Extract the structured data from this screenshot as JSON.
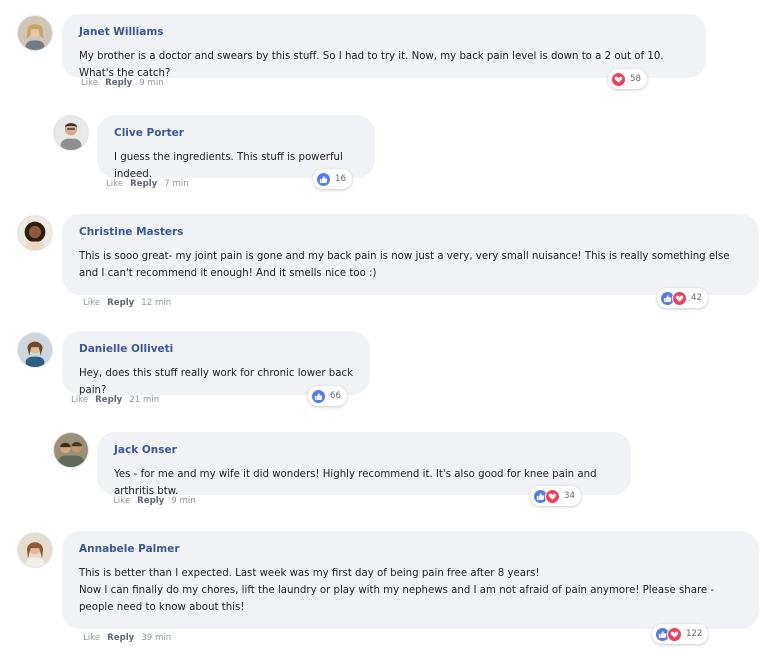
{
  "comments": [
    {
      "author": "Janet Williams",
      "text": [
        "My brother is a doctor and swears by this stuff. So I had to try it. Now, my back pain level is down to a 2 out of 10. What's the catch?"
      ],
      "like_label": "Like",
      "reply_label": "Reply",
      "time": "9 min",
      "reactions": [
        "love"
      ],
      "reaction_count": "58"
    },
    {
      "author": "Clive Porter",
      "text": [
        "I guess the ingredients. This stuff is powerful indeed."
      ],
      "like_label": "Like",
      "reply_label": "Reply",
      "time": "7 min",
      "reactions": [
        "like"
      ],
      "reaction_count": "16"
    },
    {
      "author": "Christine Masters",
      "text": [
        "This is sooo great- my joint pain is gone and my back pain is now just a very, very small nuisance! This is really something else and I can't recommend it enough! And it smells nice too :)"
      ],
      "like_label": "Like",
      "reply_label": "Reply",
      "time": "12 min",
      "reactions": [
        "like",
        "love"
      ],
      "reaction_count": "42"
    },
    {
      "author": "Danielle Olliveti",
      "text": [
        "Hey, does this stuff really work for chronic lower back pain?"
      ],
      "like_label": "Like",
      "reply_label": "Reply",
      "time": "21 min",
      "reactions": [
        "like"
      ],
      "reaction_count": "66"
    },
    {
      "author": "Jack Onser",
      "text": [
        "Yes - for me and my wife it did wonders! Highly recommend it. It's also good for knee pain and arthritis btw."
      ],
      "like_label": "Like",
      "reply_label": "Reply",
      "time": "9 min",
      "reactions": [
        "like",
        "love"
      ],
      "reaction_count": "34"
    },
    {
      "author": "Annabele Palmer",
      "text": [
        "This is better than I expected. Last week was my first day of being pain free after 8 years!",
        "Now I can finally do my chores, lift the laundry or play with my nephews and I am not afraid of pain anymore! Please share -people need to know about this!"
      ],
      "like_label": "Like",
      "reply_label": "Reply",
      "time": "39 min",
      "reactions": [
        "like",
        "love"
      ],
      "reaction_count": "122"
    }
  ],
  "colors": {
    "author": "#385898",
    "bubble": "#f0f2f5",
    "like_icon": "#4f7fe6",
    "love_icon": "#ef3f5b"
  },
  "icons": {
    "like": "thumbs-up-icon",
    "love": "heart-icon"
  }
}
